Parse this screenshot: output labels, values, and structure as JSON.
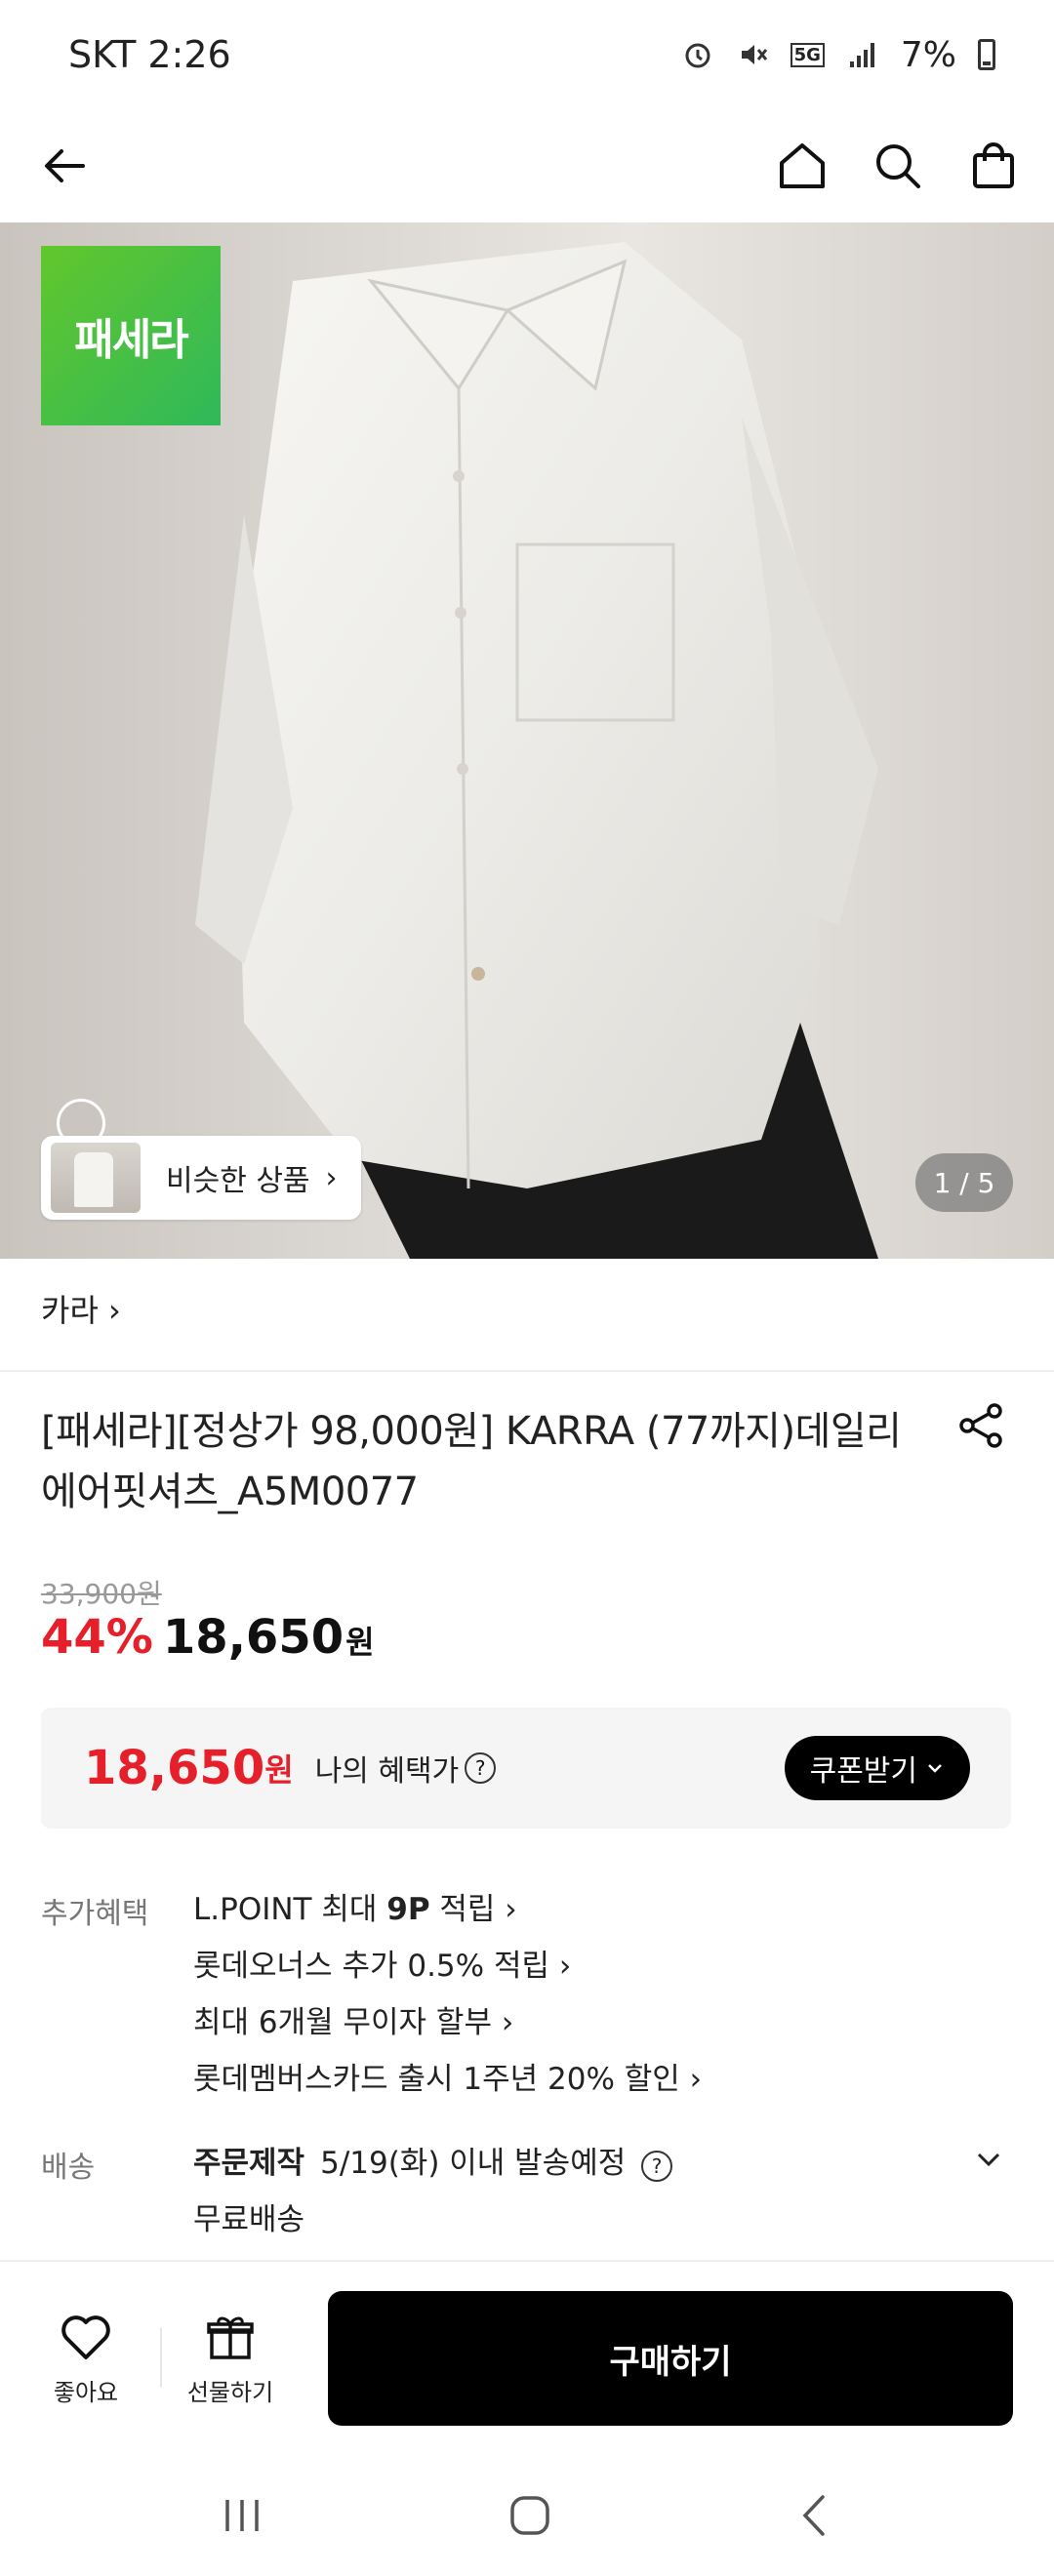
{
  "status_bar": {
    "carrier_time": "SKT 2:26",
    "battery": "7%"
  },
  "hero": {
    "brand_logo_text": "패세라",
    "similar_label": "비슷한 상품",
    "page_indicator": "1 / 5"
  },
  "category": "카라 ›",
  "product": {
    "title": "[패세라][정상가 98,000원] KARRA (77까지)데일리에어핏셔츠_A5M0077",
    "original_price": "33,900원",
    "discount": "44%",
    "sale_price": "18,650",
    "won": "원"
  },
  "benefit_box": {
    "price": "18,650",
    "won": "원",
    "label": "나의 혜택가",
    "coupon_button": "쿠폰받기"
  },
  "extra_benefits": {
    "label": "추가혜택",
    "items": [
      {
        "pre": "L.POINT 최대 ",
        "bold": "9P",
        "post": " 적립 ›"
      },
      {
        "text": "롯데오너스 추가 0.5% 적립 ›"
      },
      {
        "text": "최대 6개월 무이자 할부 ›"
      },
      {
        "text": "롯데멤버스카드 출시 1주년 20% 할인 ›"
      }
    ]
  },
  "delivery": {
    "label": "배송",
    "type": "주문제작",
    "date": "5/19(화) 이내 발송예정",
    "shipping": "무료배송"
  },
  "bottom_bar": {
    "like_label": "좋아요",
    "gift_label": "선물하기",
    "buy_label": "구매하기"
  },
  "colors": {
    "accent_red": "#e5202a",
    "brand_green": "#3dbd4a",
    "button_black": "#000000"
  },
  "icons": [
    "back-arrow-icon",
    "home-icon",
    "search-icon",
    "shopping-bag-icon",
    "share-icon",
    "help-icon",
    "chevron-down-icon",
    "heart-icon",
    "gift-icon"
  ]
}
